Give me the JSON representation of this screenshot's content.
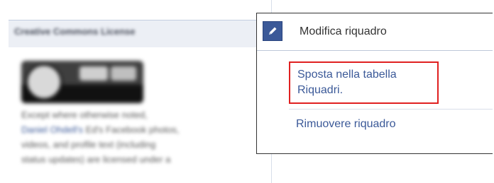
{
  "box": {
    "title": "Creative Commons License",
    "license_lines": [
      "Except where otherwise noted,",
      "Ed's Facebook photos,",
      "videos, and profile text (including",
      "status updates) are licensed under a"
    ],
    "license_link_text": "Daniel Ohdell's"
  },
  "menu": {
    "edit_label": "Modifica riquadro",
    "move_label": "Sposta nella tabella Riquadri.",
    "remove_label": "Rimuovere riquadro",
    "edit_icon": "pencil-icon"
  },
  "colors": {
    "link": "#3b5998",
    "highlight_border": "#e02020",
    "header_bg": "#eceff5"
  }
}
